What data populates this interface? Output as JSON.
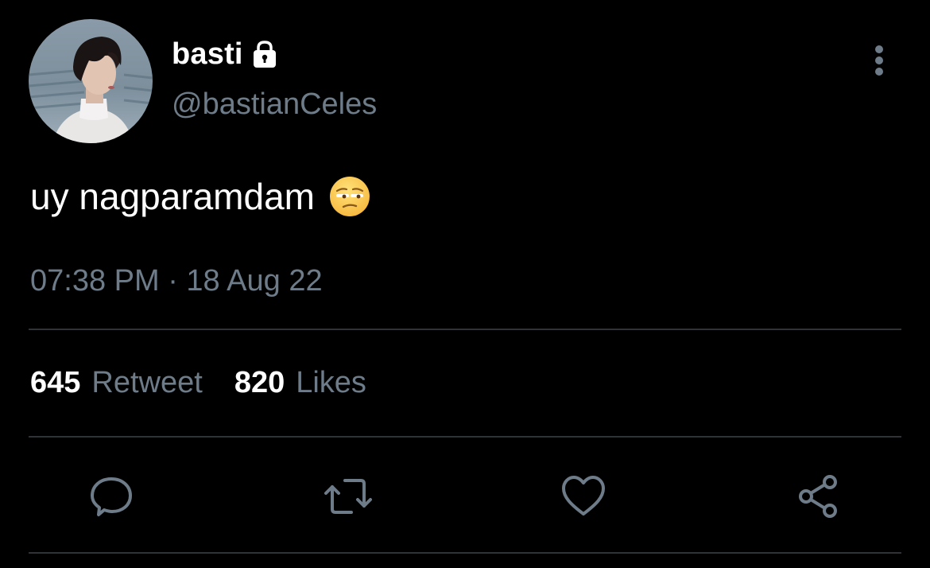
{
  "tweet": {
    "author": {
      "display_name": "basti",
      "handle": "@bastianCeles",
      "protected_icon": "lock-icon",
      "avatar": "profile-photo"
    },
    "text": "uy nagparamdam",
    "emoji": "unamused-face-emoji",
    "timestamp": "07:38 PM · 18 Aug 22",
    "stats": {
      "retweets_count": "645",
      "retweets_label": "Retweet",
      "likes_count": "820",
      "likes_label": "Likes"
    },
    "actions": [
      {
        "name": "reply",
        "icon": "comment-icon"
      },
      {
        "name": "retweet",
        "icon": "retweet-icon"
      },
      {
        "name": "like",
        "icon": "heart-icon"
      },
      {
        "name": "share",
        "icon": "share-icon"
      }
    ]
  },
  "colors": {
    "background": "#000000",
    "primary_text": "#ffffff",
    "secondary_text": "#6e7c8a",
    "divider": "#2f3336"
  }
}
